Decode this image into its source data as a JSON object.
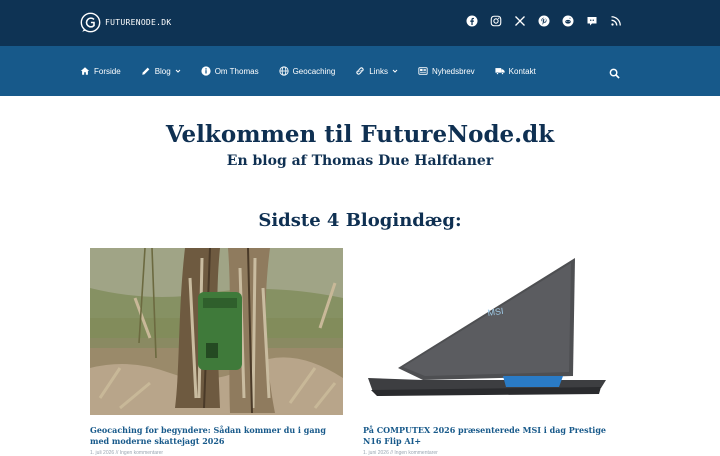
{
  "site": {
    "logo_text": "FUTURENODE.DK"
  },
  "socials": [
    {
      "icon": "facebook-icon"
    },
    {
      "icon": "instagram-icon"
    },
    {
      "icon": "x-icon"
    },
    {
      "icon": "pinterest-icon"
    },
    {
      "icon": "reddit-icon"
    },
    {
      "icon": "discord-icon"
    },
    {
      "icon": "rss-icon"
    }
  ],
  "nav": {
    "items": [
      {
        "label": "Forside",
        "icon": "home-icon"
      },
      {
        "label": "Blog",
        "icon": "pencil-icon",
        "dropdown": true
      },
      {
        "label": "Om Thomas",
        "icon": "info-icon"
      },
      {
        "label": "Geocaching",
        "icon": "globe-icon"
      },
      {
        "label": "Links",
        "icon": "link-icon",
        "dropdown": true
      },
      {
        "label": "Nyhedsbrev",
        "icon": "newsletter-icon"
      },
      {
        "label": "Kontakt",
        "icon": "truck-icon"
      }
    ],
    "search_icon": "search-icon"
  },
  "hero": {
    "title": "Velkommen til FutureNode.dk",
    "subtitle": "En blog af Thomas Due Halfdaner"
  },
  "posts_section": {
    "title": "Sidste 4 Blogindæg:",
    "posts": [
      {
        "title": "Geocaching for begyndere: Sådan kommer du i gang med moderne skattejagt 2026",
        "meta": "1. juli 2026 // Ingen kommentarer"
      },
      {
        "title": "På COMPUTEX 2026 præsenterede MSI i dag Prestige N16 Flip AI+",
        "meta": "1. juni 2026 // Ingen kommentarer"
      }
    ]
  },
  "colors": {
    "topbar": "#0e3354",
    "navbar": "#17598a",
    "heading": "#0f3052",
    "link": "#17598a"
  }
}
